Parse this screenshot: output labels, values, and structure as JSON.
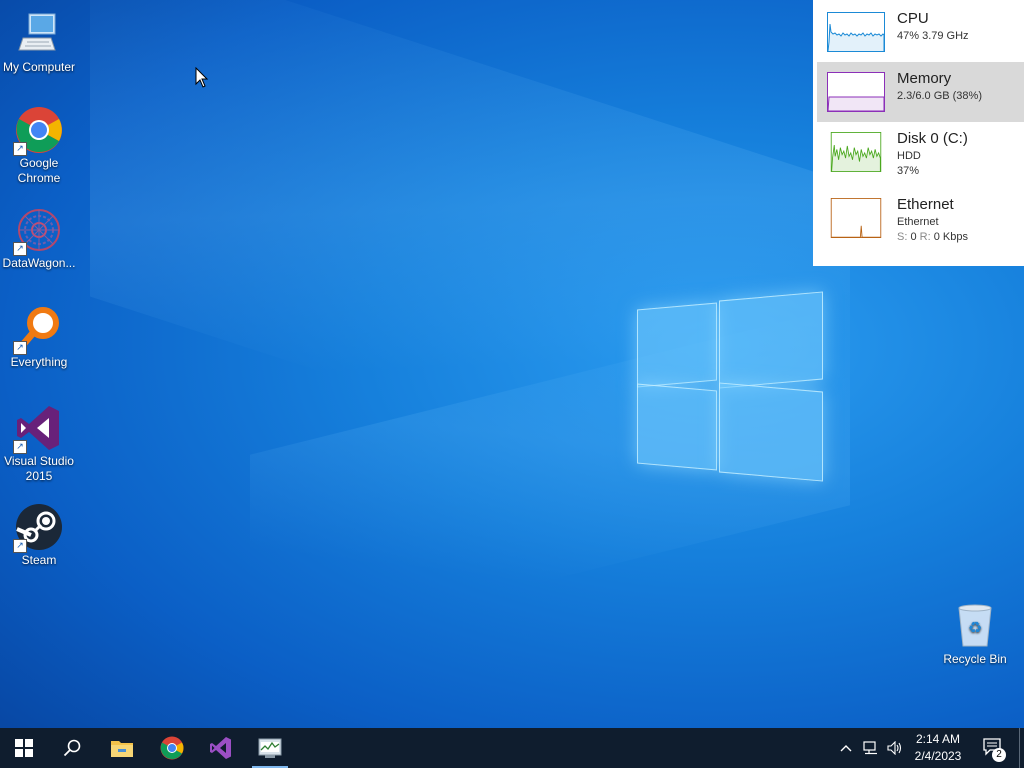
{
  "desktop": {
    "icons": [
      {
        "label": "My Computer"
      },
      {
        "label": "Google\nChrome"
      },
      {
        "label": "DataWagon..."
      },
      {
        "label": "Everything"
      },
      {
        "label": "Visual Studio\n2015"
      },
      {
        "label": "Steam"
      },
      {
        "label": "Recycle Bin"
      }
    ]
  },
  "perf_panel": {
    "cpu": {
      "title": "CPU",
      "detail": "47%  3.79 GHz",
      "color": "#1b8ad6"
    },
    "memory": {
      "title": "Memory",
      "detail": "2.3/6.0 GB (38%)",
      "color": "#8b2fb8"
    },
    "disk": {
      "title": "Disk 0 (C:)",
      "type": "HDD",
      "usage": "37%",
      "color": "#4aa81e"
    },
    "ethernet": {
      "title": "Ethernet",
      "adapter": "Ethernet",
      "send_label": "S:",
      "send_value": "0",
      "recv_label": "R:",
      "recv_value": "0 Kbps",
      "color": "#b86214"
    }
  },
  "taskbar": {
    "pinned": [
      "start-icon",
      "search-icon",
      "file-explorer-icon",
      "chrome-icon",
      "visual-studio-icon",
      "task-manager-icon"
    ],
    "clock_time": "2:14 AM",
    "clock_date": "2/4/2023",
    "notification_count": "2"
  }
}
